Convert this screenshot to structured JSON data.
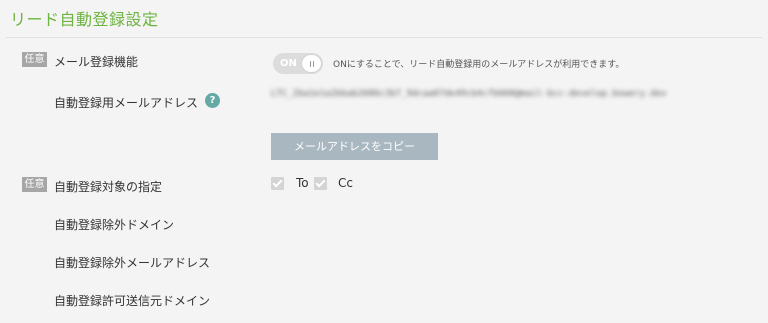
{
  "page": {
    "title": "リード自動登録設定"
  },
  "form": {
    "optional_badge": "任意",
    "mail_registration": {
      "label": "メール登録機能",
      "toggle_state": "ON",
      "note": "ONにすることで、リード自動登録用のメールアドレスが利用できます。"
    },
    "registration_email": {
      "label": "自動登録用メールアドレス",
      "help_icon": "?",
      "value_blurred": "LTC_2ba1e1a2bbab2686c3b7_9dcaa07de49cb4cfb660@mail-bcc-develop.bowery.dev",
      "copy_button_label": "メールアドレスをコピー"
    },
    "target_specification": {
      "label": "自動登録対象の指定",
      "options": [
        {
          "label": "To",
          "checked": true
        },
        {
          "label": "Cc",
          "checked": true
        }
      ]
    },
    "excluded_domains": {
      "label": "自動登録除外ドメイン"
    },
    "excluded_emails": {
      "label": "自動登録除外メールアドレス"
    },
    "allowed_sender_domains": {
      "label": "自動登録許可送信元ドメイン"
    }
  },
  "colors": {
    "title_green": "#6cb33f",
    "badge_gray": "#a6a6a6",
    "help_teal": "#64a9a4",
    "button_gray_blue": "#a9b7c0",
    "background": "#f4f4f4"
  }
}
